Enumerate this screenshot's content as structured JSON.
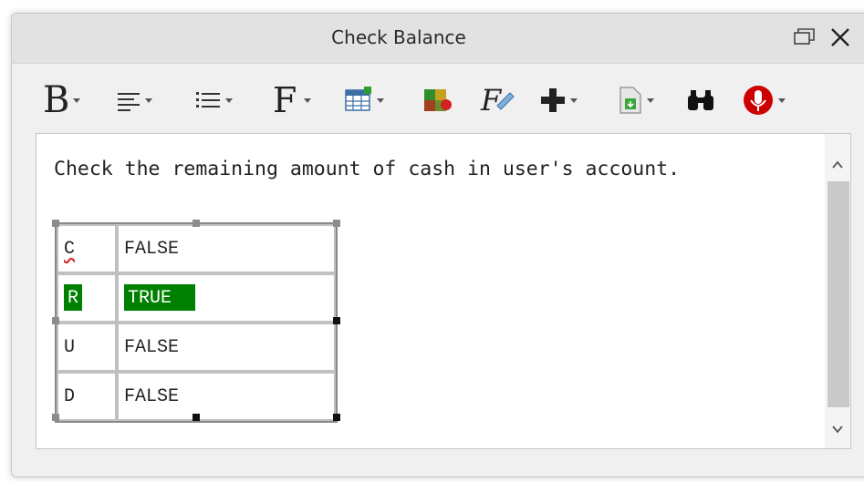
{
  "window": {
    "title": "Check Balance"
  },
  "toolbar": {
    "items": [
      {
        "name": "bold",
        "glyph": "B",
        "has_dropdown": true
      },
      {
        "name": "align",
        "glyph": "align-icon",
        "has_dropdown": true
      },
      {
        "name": "list",
        "glyph": "list-icon",
        "has_dropdown": true
      },
      {
        "name": "font",
        "glyph": "F",
        "has_dropdown": true
      },
      {
        "name": "table",
        "glyph": "table-icon",
        "has_dropdown": true
      },
      {
        "name": "color",
        "glyph": "color-palette-icon",
        "has_dropdown": false
      },
      {
        "name": "formula",
        "glyph": "formula-icon",
        "has_dropdown": false
      },
      {
        "name": "insert",
        "glyph": "plus-icon",
        "has_dropdown": true
      },
      {
        "name": "document",
        "glyph": "document-icon",
        "has_dropdown": true
      },
      {
        "name": "find",
        "glyph": "binoculars-icon",
        "has_dropdown": false
      },
      {
        "name": "record",
        "glyph": "microphone-icon",
        "has_dropdown": true
      }
    ]
  },
  "editor": {
    "text": "Check the remaining amount of cash in user's account.",
    "table": {
      "rows": [
        {
          "key": "C",
          "value": "FALSE",
          "highlighted": false
        },
        {
          "key": "R",
          "value": "TRUE",
          "highlighted": true
        },
        {
          "key": "U",
          "value": "FALSE",
          "highlighted": false
        },
        {
          "key": "D",
          "value": "FALSE",
          "highlighted": false
        }
      ]
    }
  },
  "colors": {
    "highlight": "#008000",
    "record": "#cc0000",
    "titlebar": "#e2e2e2"
  }
}
